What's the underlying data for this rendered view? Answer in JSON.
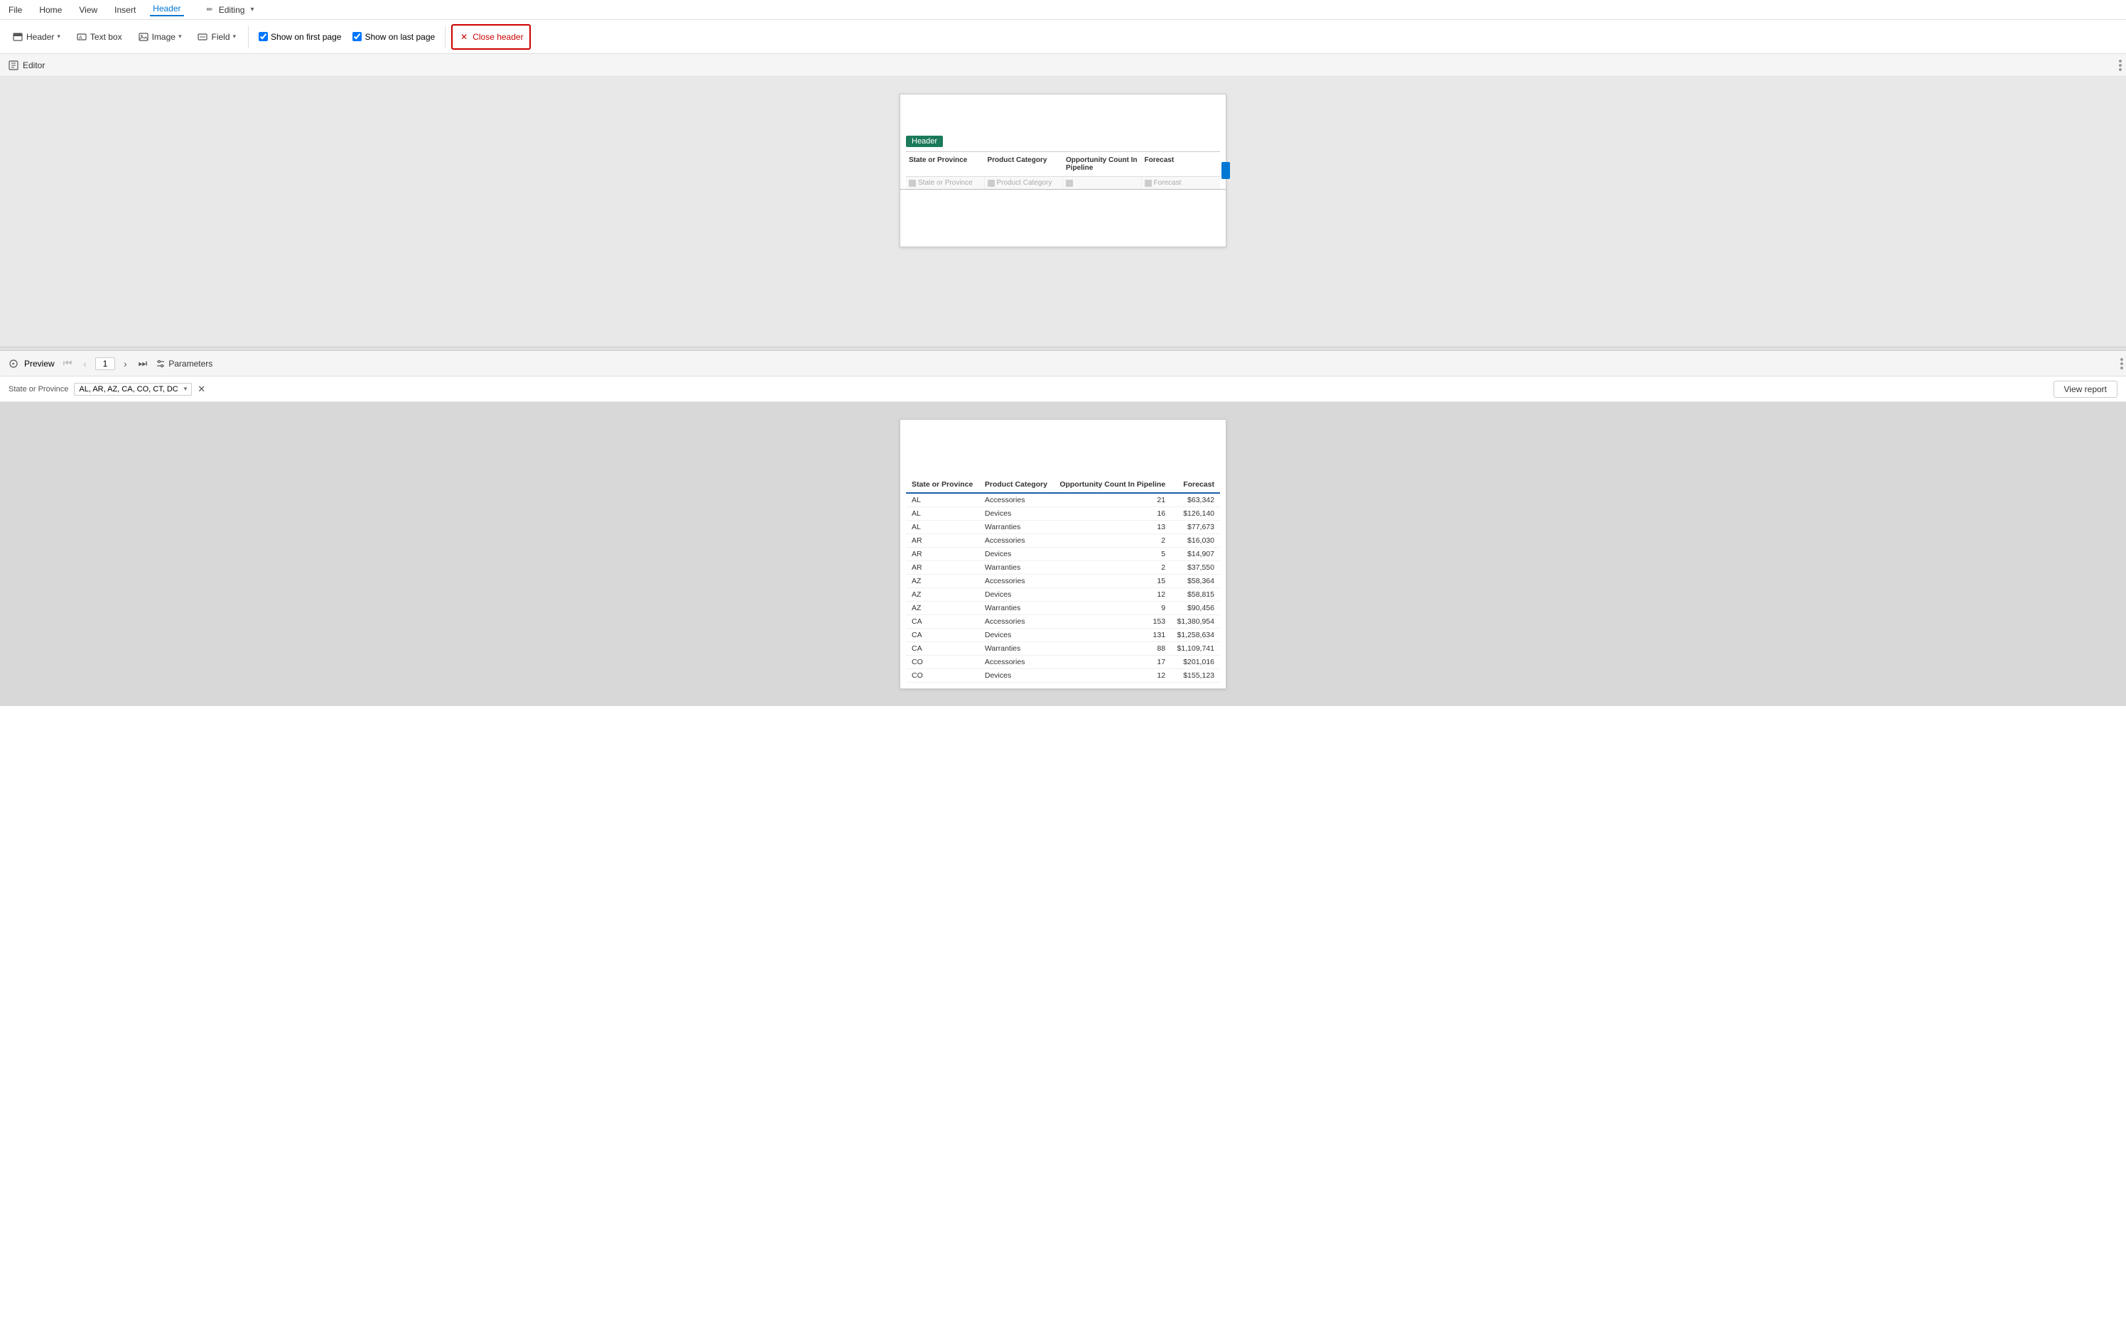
{
  "menu": {
    "items": [
      "File",
      "Home",
      "View",
      "Insert",
      "Header"
    ],
    "active": "Header",
    "editing_label": "Editing"
  },
  "ribbon": {
    "header_btn": "Header",
    "textbox_btn": "Text box",
    "image_btn": "Image",
    "field_btn": "Field",
    "show_first_page_label": "Show on first page",
    "show_last_page_label": "Show on last page",
    "close_header_btn": "Close header",
    "show_first_checked": true,
    "show_last_checked": true
  },
  "editor": {
    "label": "Editor",
    "header_tag": "Header",
    "table_columns": [
      "State or Province",
      "Product Category",
      "Opportunity Count In Pipeline",
      "Forecast"
    ],
    "table_placeholders": [
      "State or Province",
      "Product Category",
      "",
      "Forecast"
    ]
  },
  "preview": {
    "label": "Preview",
    "current_page": "1",
    "parameters_label": "Parameters"
  },
  "params": {
    "label": "State or Province",
    "value": "AL, AR, AZ, CA, CO, CT, DC",
    "view_report_btn": "View report"
  },
  "data_table": {
    "columns": [
      "State or Province",
      "Product Category",
      "Opportunity Count In Pipeline",
      "Forecast"
    ],
    "rows": [
      [
        "AL",
        "Accessories",
        "21",
        "$63,342"
      ],
      [
        "AL",
        "Devices",
        "16",
        "$126,140"
      ],
      [
        "AL",
        "Warranties",
        "13",
        "$77,673"
      ],
      [
        "AR",
        "Accessories",
        "2",
        "$16,030"
      ],
      [
        "AR",
        "Devices",
        "5",
        "$14,907"
      ],
      [
        "AR",
        "Warranties",
        "2",
        "$37,550"
      ],
      [
        "AZ",
        "Accessories",
        "15",
        "$58,364"
      ],
      [
        "AZ",
        "Devices",
        "12",
        "$58,815"
      ],
      [
        "AZ",
        "Warranties",
        "9",
        "$90,456"
      ],
      [
        "CA",
        "Accessories",
        "153",
        "$1,380,954"
      ],
      [
        "CA",
        "Devices",
        "131",
        "$1,258,634"
      ],
      [
        "CA",
        "Warranties",
        "88",
        "$1,109,741"
      ],
      [
        "CO",
        "Accessories",
        "17",
        "$201,016"
      ],
      [
        "CO",
        "Devices",
        "12",
        "$155,123"
      ]
    ]
  },
  "colors": {
    "accent_blue": "#0078d4",
    "header_green": "#1a7a5a",
    "close_header_red": "#c00000",
    "table_header_blue": "#1a5fa8"
  }
}
